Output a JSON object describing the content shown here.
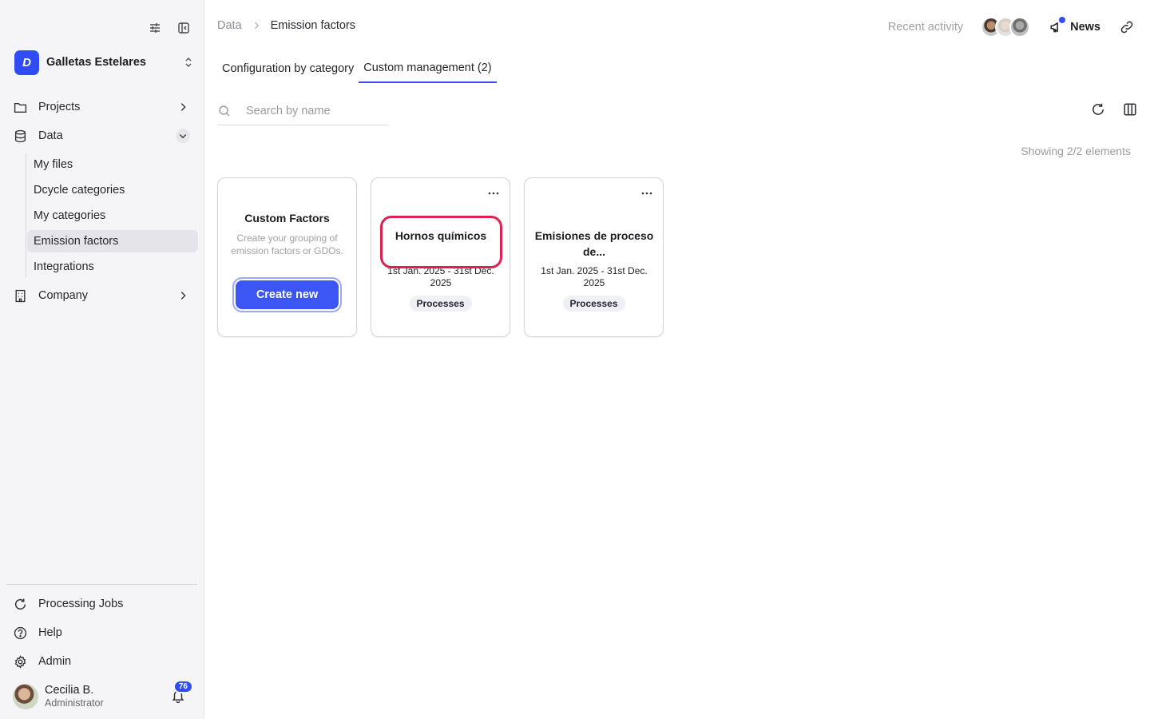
{
  "sidebar": {
    "org_name": "Galletas Estelares",
    "org_logo_letter": "D",
    "nav": {
      "projects": "Projects",
      "data": "Data",
      "company": "Company"
    },
    "data_subitems": [
      "My files",
      "Dcycle categories",
      "My categories",
      "Emission factors",
      "Integrations"
    ],
    "active_subitem": "Emission factors",
    "bottom": {
      "processing_jobs": "Processing Jobs",
      "help": "Help",
      "admin": "Admin"
    },
    "user": {
      "name": "Cecilia B.",
      "role": "Administrator",
      "notifications": "76"
    }
  },
  "header": {
    "breadcrumb_root": "Data",
    "breadcrumb_current": "Emission factors",
    "recent_activity": "Recent activity",
    "news": "News"
  },
  "tabs": [
    "Configuration by category",
    "Custom management (2)"
  ],
  "active_tab": "Custom management (2)",
  "search": {
    "placeholder": "Search by name"
  },
  "showing": "Showing 2/2 elements",
  "create_card": {
    "title": "Custom Factors",
    "description": "Create your grouping of emission factors or GDOs.",
    "button": "Create new"
  },
  "cards": [
    {
      "title": "Hornos químicos",
      "date": "1st Jan. 2025 - 31st Dec. 2025",
      "tag": "Processes",
      "highlighted": true
    },
    {
      "title": "Emisiones de proceso de...",
      "date": "1st Jan. 2025 - 31st Dec. 2025",
      "tag": "Processes",
      "highlighted": false
    }
  ],
  "colors": {
    "accent": "#2f4cf5",
    "highlight": "#e0204e",
    "sidebar_bg": "#f5f5f7"
  }
}
